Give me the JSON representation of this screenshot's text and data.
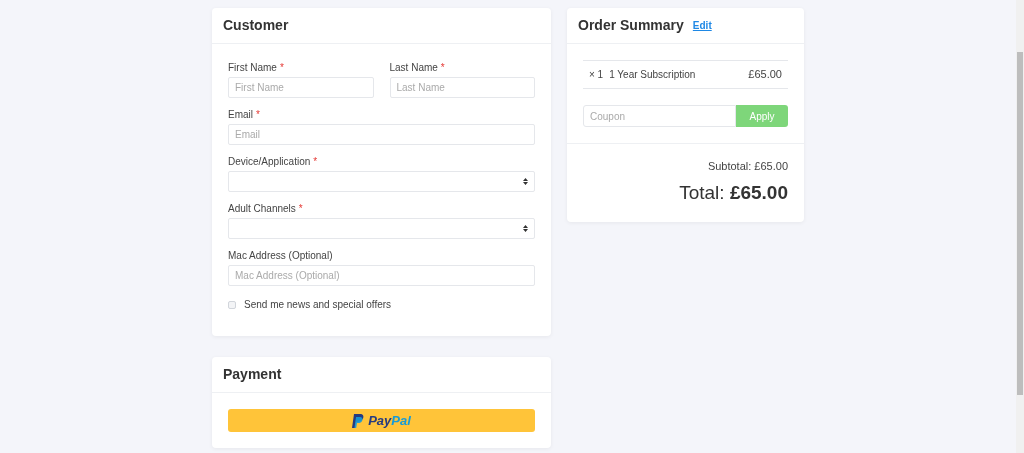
{
  "customer": {
    "title": "Customer",
    "field_rows": [
      [
        {
          "kind": "text",
          "label": "First Name",
          "required_mark": "*",
          "placeholder": "First Name"
        },
        {
          "kind": "text",
          "label": "Last Name",
          "required_mark": "*",
          "placeholder": "Last Name"
        }
      ],
      [
        {
          "kind": "text",
          "label": "Email",
          "required_mark": "*",
          "placeholder": "Email"
        }
      ],
      [
        {
          "kind": "select",
          "label": "Device/Application",
          "required_mark": "*"
        }
      ],
      [
        {
          "kind": "select",
          "label": "Adult Channels",
          "required_mark": "*"
        }
      ],
      [
        {
          "kind": "text",
          "label": "Mac Address (Optional)",
          "placeholder": "Mac Address (Optional)"
        }
      ]
    ],
    "newsletter": {
      "label": "Send me news and special offers",
      "checked": false
    }
  },
  "payment": {
    "title": "Payment",
    "paypal_parts": [
      "Pay",
      "Pal"
    ]
  },
  "order_summary": {
    "title": "Order Summary",
    "edit_link": "Edit",
    "items": [
      {
        "quantity": "× 1",
        "name": "1 Year Subscription",
        "price": "£65.00"
      }
    ],
    "coupon": {
      "placeholder": "Coupon",
      "button": "Apply"
    },
    "subtotal": "Subtotal: £65.00",
    "total": "Total: **£65.00**"
  }
}
